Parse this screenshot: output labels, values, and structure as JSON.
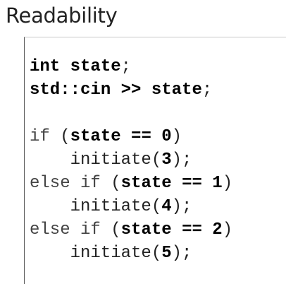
{
  "title": "Readability",
  "code": {
    "decl_type": "int",
    "decl_var": "state",
    "decl_semicolon": ";",
    "io_stream": "std::cin",
    "io_op": ">>",
    "io_var": "state",
    "io_semicolon": ";",
    "if_kw": "if",
    "elseif_kw": "else if",
    "open_paren": "(",
    "close_paren": ")",
    "cond_var": "state",
    "cond_op": "==",
    "call_name": "initiate",
    "call_open": "(",
    "call_close": ");",
    "branches": [
      {
        "compare": "0",
        "arg": "3"
      },
      {
        "compare": "1",
        "arg": "4"
      },
      {
        "compare": "2",
        "arg": "5"
      }
    ]
  }
}
